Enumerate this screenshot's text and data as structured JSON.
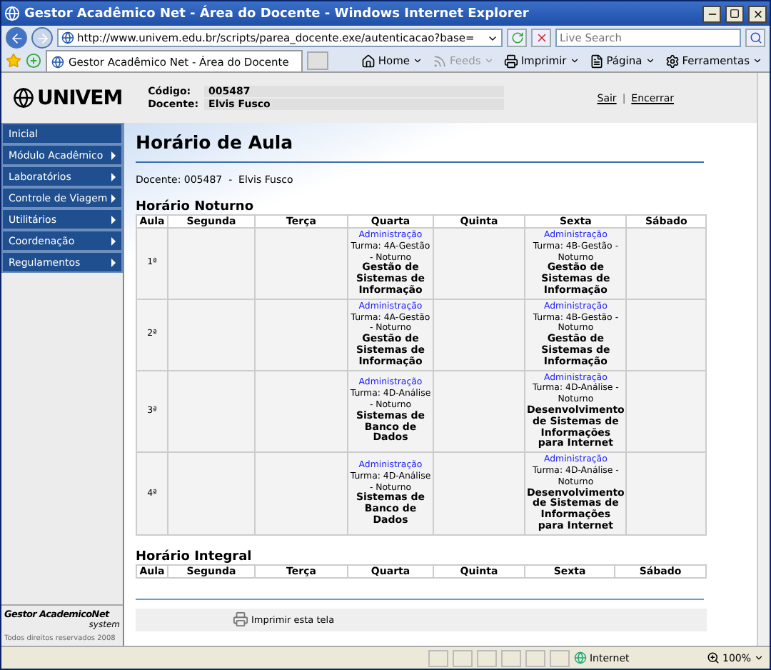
{
  "window": {
    "title": "Gestor Acadêmico Net - Área do Docente - Windows Internet Explorer"
  },
  "address_bar": {
    "url": "http://www.univem.edu.br/scripts/parea_docente.exe/autenticacao?base=",
    "search_placeholder": "Live Search"
  },
  "tab": {
    "title": "Gestor Acadêmico Net - Área do Docente"
  },
  "toolbar": [
    {
      "kind": "home",
      "label": "Home",
      "disabled": false
    },
    {
      "kind": "feeds",
      "label": "Feeds",
      "disabled": true
    },
    {
      "kind": "print",
      "label": "Imprimir",
      "disabled": false
    },
    {
      "kind": "page",
      "label": "Página",
      "disabled": false
    },
    {
      "kind": "tools",
      "label": "Ferramentas",
      "disabled": false
    }
  ],
  "header": {
    "logo": "UNIVEM",
    "fields": [
      {
        "label": "Código:",
        "value": "005487"
      },
      {
        "label": "Docente:",
        "value": "Elvis Fusco"
      }
    ],
    "links": [
      "Sair",
      "Encerrar"
    ],
    "link_separator": "|"
  },
  "sidebar": {
    "items": [
      {
        "label": "Inicial",
        "submenu": false
      },
      {
        "label": "Módulo Acadêmico",
        "submenu": true
      },
      {
        "label": "Laboratórios",
        "submenu": true
      },
      {
        "label": "Controle de Viagem",
        "submenu": true
      },
      {
        "label": "Utilitários",
        "submenu": true
      },
      {
        "label": "Coordenação",
        "submenu": true
      },
      {
        "label": "Regulamentos",
        "submenu": true
      }
    ],
    "footer_logo": "Gestor AcademicoNet",
    "footer_logo_sub": "system",
    "copyright": "Todos direitos reservados 2008"
  },
  "page_title": "Horário de Aula",
  "docente_line": "Docente: 005487  -  Elvis Fusco",
  "sections": [
    {
      "title": "Horário Noturno",
      "columns": [
        "Aula",
        "Segunda",
        "Terça",
        "Quarta",
        "Quinta",
        "Sexta",
        "Sábado"
      ],
      "rows": [
        {
          "aula": "1ª",
          "cells": [
            {
              "kind": "empty"
            },
            {
              "kind": "empty"
            },
            {
              "kind": "class",
              "course": "Administração",
              "turma": "Turma: 4A-Gestão - Noturno",
              "subject": "Gestão de Sistemas de Informação"
            },
            {
              "kind": "empty"
            },
            {
              "kind": "class",
              "course": "Administração",
              "turma": "Turma: 4B-Gestão - Noturno",
              "subject": "Gestão de Sistemas de Informação"
            },
            {
              "kind": "empty"
            }
          ]
        },
        {
          "aula": "2ª",
          "cells": [
            {
              "kind": "empty"
            },
            {
              "kind": "empty"
            },
            {
              "kind": "class",
              "course": "Administração",
              "turma": "Turma: 4A-Gestão - Noturno",
              "subject": "Gestão de Sistemas de Informação"
            },
            {
              "kind": "empty"
            },
            {
              "kind": "class",
              "course": "Administração",
              "turma": "Turma: 4B-Gestão - Noturno",
              "subject": "Gestão de Sistemas de Informação"
            },
            {
              "kind": "empty"
            }
          ]
        },
        {
          "aula": "3ª",
          "cells": [
            {
              "kind": "empty"
            },
            {
              "kind": "empty"
            },
            {
              "kind": "class",
              "course": "Administração",
              "turma": "Turma: 4D-Análise - Noturno",
              "subject": "Sistemas de Banco de Dados"
            },
            {
              "kind": "empty"
            },
            {
              "kind": "class",
              "course": "Administração",
              "turma": "Turma: 4D-Análise - Noturno",
              "subject": "Desenvolvimento de Sistemas de Informações para Internet"
            },
            {
              "kind": "empty"
            }
          ]
        },
        {
          "aula": "4ª",
          "cells": [
            {
              "kind": "empty"
            },
            {
              "kind": "empty"
            },
            {
              "kind": "class",
              "course": "Administração",
              "turma": "Turma: 4D-Análise - Noturno",
              "subject": "Sistemas de Banco de Dados"
            },
            {
              "kind": "empty"
            },
            {
              "kind": "class",
              "course": "Administração",
              "turma": "Turma: 4D-Análise - Noturno",
              "subject": "Desenvolvimento de Sistemas de Informações para Internet"
            },
            {
              "kind": "empty"
            }
          ]
        }
      ]
    },
    {
      "title": "Horário Integral",
      "columns": [
        "Aula",
        "Segunda",
        "Terça",
        "Quarta",
        "Quinta",
        "Sexta",
        "Sábado"
      ]
    }
  ],
  "print_label": "Imprimir esta tela",
  "status_bar": {
    "zone": "Internet",
    "zoom": "100%"
  }
}
